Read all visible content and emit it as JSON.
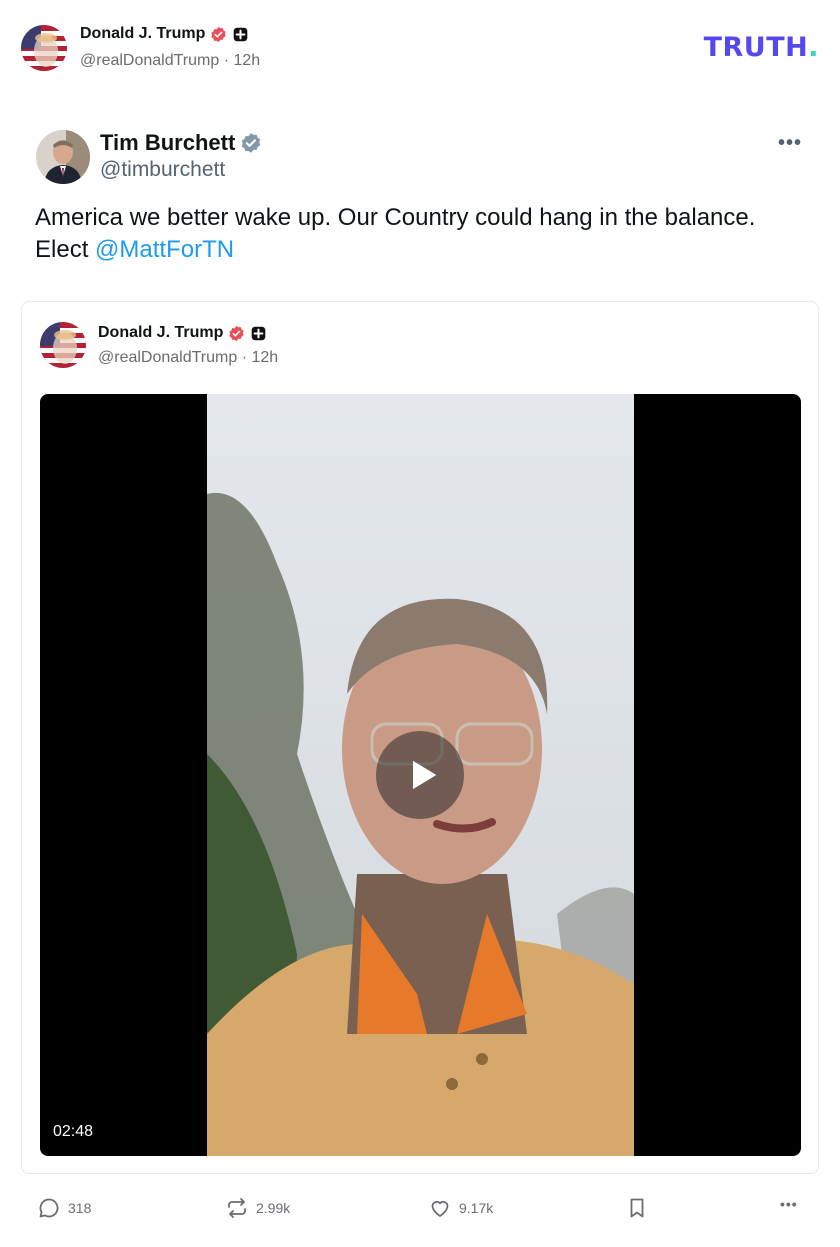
{
  "post": {
    "author_name": "Donald J. Trump",
    "author_handle": "@realDonaldTrump",
    "separator": "·",
    "time": "12h",
    "logo_text": "TRUTH",
    "logo_dot": "."
  },
  "embedded_tweet": {
    "author_name": "Tim Burchett",
    "author_handle": "@timburchett",
    "text": "America we better wake up. Our Country could hang in the balance. Elect ",
    "mention": "@MattForTN",
    "more_label": "•••"
  },
  "quote": {
    "author_name": "Donald J. Trump",
    "author_handle": "@realDonaldTrump",
    "separator": "·",
    "time": "12h",
    "video_duration": "02:48"
  },
  "actions": {
    "replies": "318",
    "retruths": "2.99k",
    "likes": "9.17k",
    "more_label": "•••"
  },
  "colors": {
    "brand": "#5448ee",
    "mention": "#1d9bf0",
    "verified_red": "#e8505b",
    "verified_blue": "#829aab"
  },
  "icons": [
    "verified-badge-icon",
    "plus-badge-icon",
    "reply-icon",
    "retruth-icon",
    "heart-icon",
    "bookmark-icon",
    "more-icon",
    "play-icon"
  ]
}
